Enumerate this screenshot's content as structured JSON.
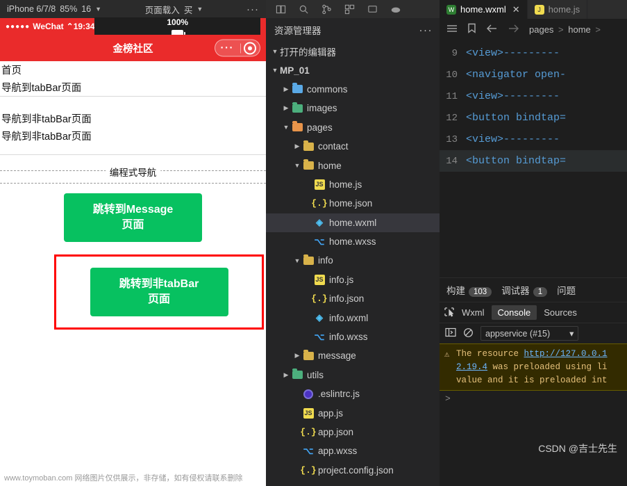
{
  "simulator": {
    "toolbar": {
      "device": "iPhone 6/7/8",
      "scale": "85%",
      "scale_ratio": "16",
      "refresh": "页面载入",
      "refresh_suffix": "买",
      "more": "···"
    },
    "status": {
      "carrier": "WeChat",
      "signal_dots": "●●●●●",
      "time": "19:34",
      "battery": "100%"
    },
    "nav_title": "金榜社区",
    "capsule": {
      "more": "···"
    },
    "lines": [
      "首页",
      "导航到tabBar页面",
      "导航到非tabBar页面",
      "导航到非tabBar页面"
    ],
    "dashed_label": "编程式导航",
    "buttons": [
      {
        "line1": "跳转到Message",
        "line2": "页面"
      },
      {
        "line1": "跳转到非tabBar",
        "line2": "页面"
      }
    ],
    "watermark": "www.toymoban.com 网络图片仅供展示，非存储，如有侵权请联系删除"
  },
  "explorer": {
    "title": "资源管理器",
    "more": "···",
    "sections": [
      {
        "label": "打开的编辑器",
        "chevron": "▼",
        "type": "section"
      },
      {
        "label": "MP_01",
        "chevron": "▼",
        "type": "section"
      }
    ],
    "tree": [
      {
        "label": "commons",
        "indent": 1,
        "chevron": "▶",
        "icon": "folder-blue",
        "selected": false
      },
      {
        "label": "images",
        "indent": 1,
        "chevron": "▶",
        "icon": "folder-green",
        "selected": false
      },
      {
        "label": "pages",
        "indent": 1,
        "chevron": "▼",
        "icon": "folder-orange",
        "selected": false
      },
      {
        "label": "contact",
        "indent": 2,
        "chevron": "▶",
        "icon": "folder-yellow",
        "selected": false
      },
      {
        "label": "home",
        "indent": 2,
        "chevron": "▼",
        "icon": "folder-yellow",
        "selected": false
      },
      {
        "label": "home.js",
        "indent": 3,
        "chevron": "",
        "icon": "js",
        "selected": false
      },
      {
        "label": "home.json",
        "indent": 3,
        "chevron": "",
        "icon": "json",
        "selected": false
      },
      {
        "label": "home.wxml",
        "indent": 3,
        "chevron": "",
        "icon": "wxml",
        "selected": true
      },
      {
        "label": "home.wxss",
        "indent": 3,
        "chevron": "",
        "icon": "wxss",
        "selected": false
      },
      {
        "label": "info",
        "indent": 2,
        "chevron": "▼",
        "icon": "folder-yellow",
        "selected": false
      },
      {
        "label": "info.js",
        "indent": 3,
        "chevron": "",
        "icon": "js",
        "selected": false
      },
      {
        "label": "info.json",
        "indent": 3,
        "chevron": "",
        "icon": "json",
        "selected": false
      },
      {
        "label": "info.wxml",
        "indent": 3,
        "chevron": "",
        "icon": "wxml",
        "selected": false
      },
      {
        "label": "info.wxss",
        "indent": 3,
        "chevron": "",
        "icon": "wxss",
        "selected": false
      },
      {
        "label": "message",
        "indent": 2,
        "chevron": "▶",
        "icon": "folder-yellow",
        "selected": false
      },
      {
        "label": "utils",
        "indent": 1,
        "chevron": "▶",
        "icon": "folder-green",
        "selected": false
      },
      {
        "label": ".eslintrc.js",
        "indent": 2,
        "chevron": "",
        "icon": "eslint",
        "selected": false
      },
      {
        "label": "app.js",
        "indent": 2,
        "chevron": "",
        "icon": "js",
        "selected": false
      },
      {
        "label": "app.json",
        "indent": 2,
        "chevron": "",
        "icon": "json",
        "selected": false
      },
      {
        "label": "app.wxss",
        "indent": 2,
        "chevron": "",
        "icon": "wxss",
        "selected": false
      },
      {
        "label": "project.config.json",
        "indent": 2,
        "chevron": "",
        "icon": "json",
        "selected": false
      }
    ]
  },
  "editor": {
    "tabs": [
      {
        "label": "home.wxml",
        "active": true,
        "close": "✕"
      },
      {
        "label": "home.js",
        "active": false,
        "close": ""
      }
    ],
    "breadcrumb": {
      "path1": "pages",
      "sep": ">",
      "path2": "home",
      "sep2": ">"
    },
    "code_lines": [
      {
        "num": "9",
        "text": "<view>---------",
        "highlight": false
      },
      {
        "num": "10",
        "text": "<navigator open-",
        "highlight": false
      },
      {
        "num": "11",
        "text": "<view>---------",
        "highlight": false
      },
      {
        "num": "12",
        "text": "<button bindtap=",
        "highlight": false
      },
      {
        "num": "13",
        "text": "<view>---------",
        "highlight": false
      },
      {
        "num": "14",
        "text": "<button bindtap=",
        "highlight": true
      }
    ]
  },
  "devtools": {
    "tabs": [
      {
        "label": "构建",
        "badge": "103"
      },
      {
        "label": "调试器",
        "badge": "1"
      },
      {
        "label": "问题",
        "badge": ""
      }
    ],
    "inner_tabs": [
      {
        "label": "Wxml",
        "selected": false
      },
      {
        "label": "Console",
        "selected": true
      },
      {
        "label": "Sources",
        "selected": false
      }
    ],
    "console_filter": "appservice (#15)",
    "warning": {
      "line1_a": "The resource ",
      "line1_link": "http://127.0.0.1",
      "line2_link": "2.19.4",
      "line2_b": " was preloaded using li",
      "line3": "value and it is preloaded int"
    },
    "prompt": ">"
  },
  "footer_watermark": "CSDN @吉士先生"
}
